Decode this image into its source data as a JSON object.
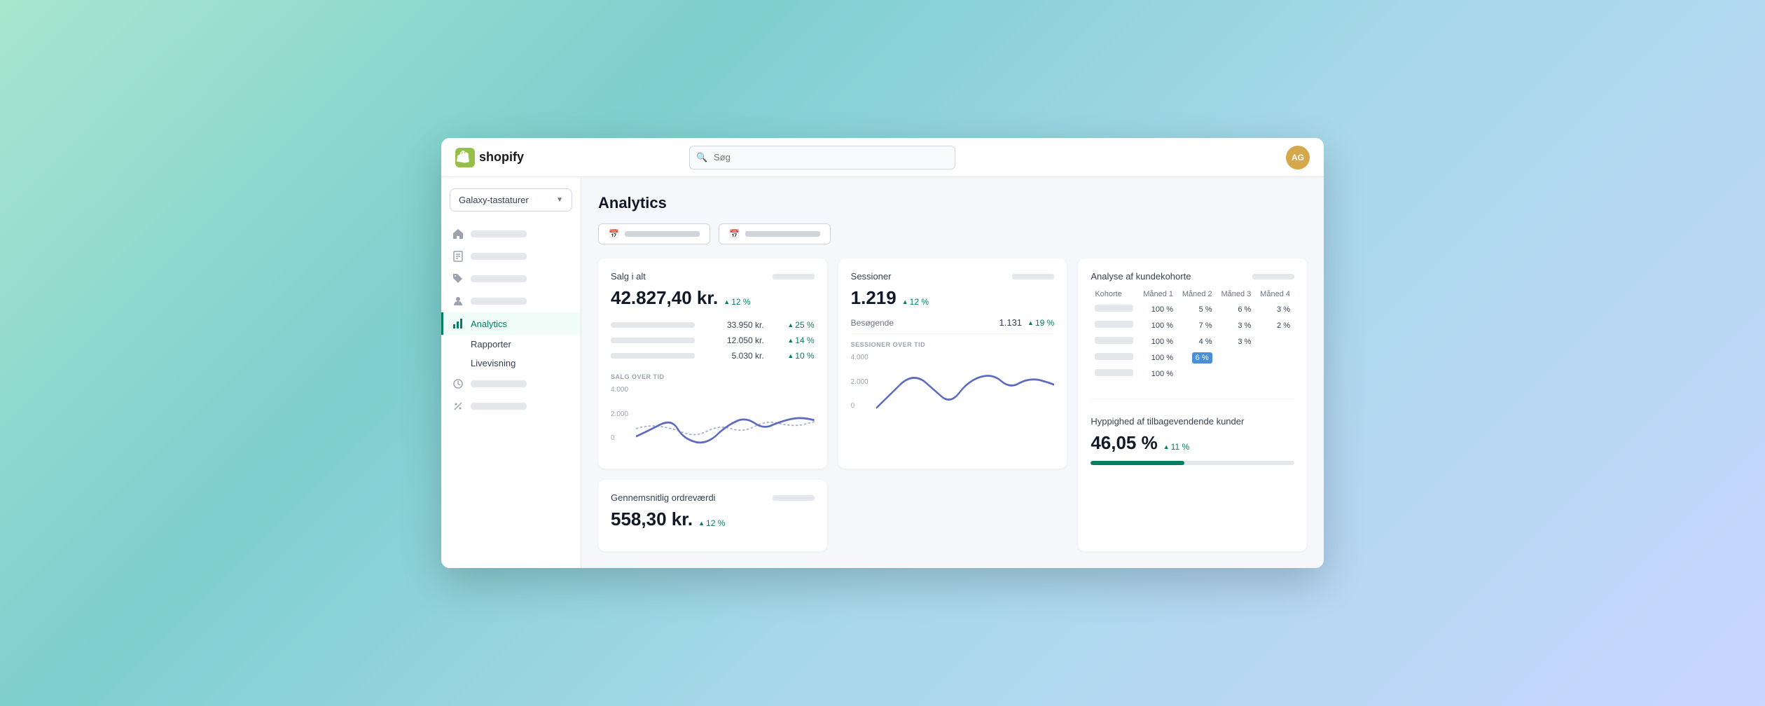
{
  "topbar": {
    "logo_text": "shopify",
    "search_placeholder": "Søg",
    "avatar_initials": "AG"
  },
  "sidebar": {
    "store_selector": "Galaxy-tastaturer",
    "nav_items": [
      {
        "id": "home",
        "icon": "home",
        "label": ""
      },
      {
        "id": "orders",
        "icon": "orders",
        "label": ""
      },
      {
        "id": "tags",
        "icon": "tags",
        "label": ""
      },
      {
        "id": "customers",
        "icon": "customers",
        "label": ""
      },
      {
        "id": "analytics",
        "icon": "analytics",
        "label": "Analytics",
        "active": true
      },
      {
        "id": "marketing",
        "icon": "marketing",
        "label": ""
      },
      {
        "id": "discounts",
        "icon": "discounts",
        "label": ""
      }
    ],
    "sub_nav": [
      {
        "label": "Rapporter"
      },
      {
        "label": "Livevisning"
      }
    ]
  },
  "page": {
    "title": "Analytics",
    "date_filter_1": "",
    "date_filter_2": ""
  },
  "cards": {
    "sales": {
      "title": "Salg i alt",
      "value": "42.827,40 kr.",
      "badge": "12 %",
      "rows": [
        {
          "value": "33.950 kr.",
          "badge": "25 %"
        },
        {
          "value": "12.050 kr.",
          "badge": "14 %"
        },
        {
          "value": "5.030 kr.",
          "badge": "10 %"
        }
      ],
      "chart_label": "SALG OVER TID",
      "y_labels": [
        "4.000",
        "2.000",
        "0"
      ]
    },
    "sessions": {
      "title": "Sessioner",
      "value": "1.219",
      "badge": "12 %",
      "sub_label": "Besøgende",
      "sub_value": "1.131",
      "sub_badge": "19 %",
      "chart_label": "SESSIONER OVER TID",
      "y_labels": [
        "4.000",
        "2.000",
        "0"
      ]
    },
    "kohorte": {
      "title": "Analyse af kundekohorte",
      "headers": [
        "Kohorte",
        "Måned 1",
        "Måned 2",
        "Måned 3",
        "Måned 4"
      ],
      "rows": [
        {
          "cells": [
            "100 %",
            "5 %",
            "6 %",
            "3 %"
          ]
        },
        {
          "cells": [
            "100 %",
            "7 %",
            "3 %",
            "2 %"
          ]
        },
        {
          "cells": [
            "100 %",
            "4 %",
            "3 %",
            ""
          ]
        },
        {
          "cells": [
            "100 %",
            "6 %",
            "",
            ""
          ]
        },
        {
          "cells": [
            "100 %",
            "",
            "",
            ""
          ]
        }
      ]
    },
    "order_value": {
      "title": "Gennemsnitlig ordreværdi",
      "value": "558,30 kr.",
      "badge": "12 %"
    },
    "returning": {
      "title": "Hyppighed af tilbagevendende kunder",
      "value": "46,05 %",
      "badge": "11 %",
      "progress": 46
    }
  }
}
